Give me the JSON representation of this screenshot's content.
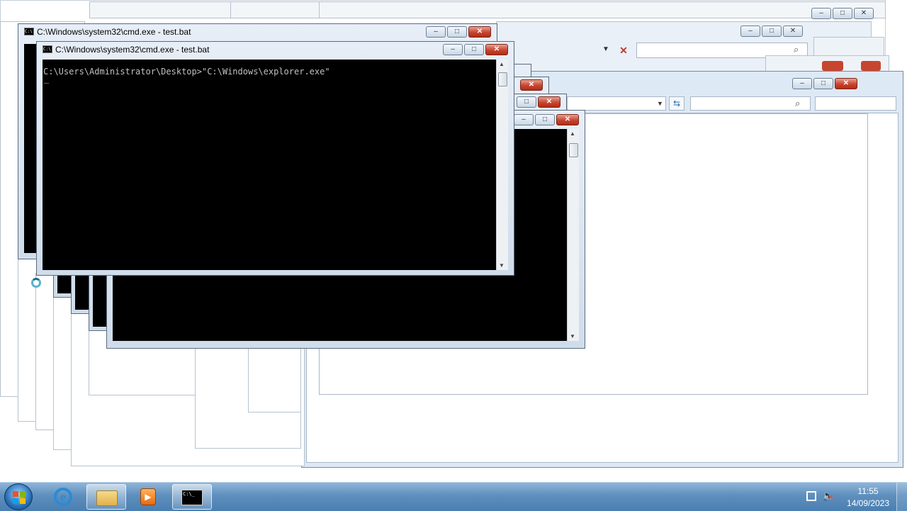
{
  "cmd_window_back": {
    "title": "C:\\Windows\\system32\\cmd.exe - test.bat"
  },
  "cmd_window_front": {
    "title": "C:\\Windows\\system32\\cmd.exe - test.bat",
    "console_line": "C:\\Users\\Administrator\\Desktop>\"C:\\Windows\\explorer.exe\"",
    "cursor": "_"
  },
  "caption": {
    "minimize": "–",
    "maximize": "□",
    "close": "✕"
  },
  "explorer": {
    "search_icon": "search-icon",
    "refresh_icon": "refresh-icon"
  },
  "taskbar": {
    "pinned": [
      {
        "name": "internet-explorer-icon"
      },
      {
        "name": "file-explorer-icon"
      },
      {
        "name": "media-player-icon"
      },
      {
        "name": "command-prompt-icon"
      }
    ],
    "clock_time": "11:55",
    "clock_date": "14/09/2023"
  },
  "colors": {
    "taskbar": "#5e8fbd",
    "console_bg": "#000000",
    "close_button": "#c7452f"
  }
}
